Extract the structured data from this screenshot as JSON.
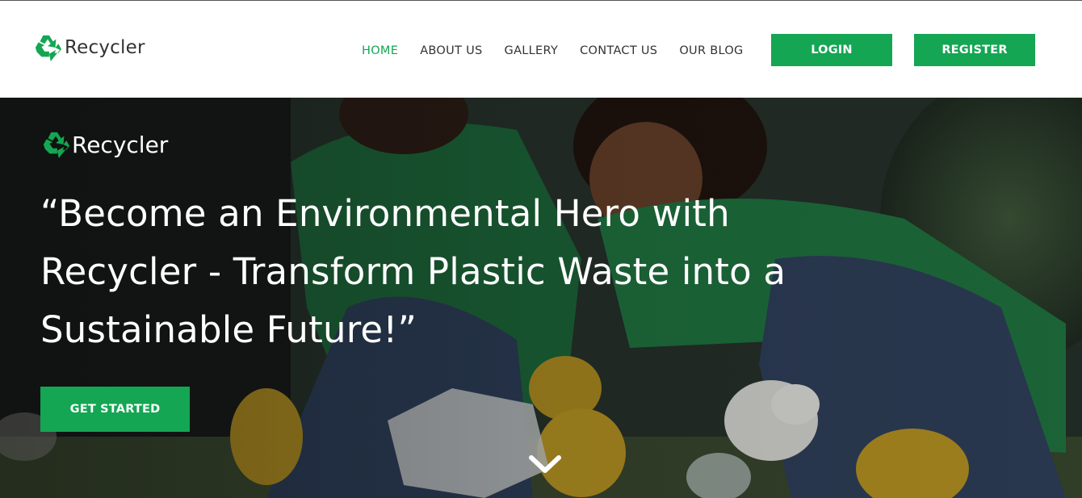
{
  "brand": {
    "name": "Recycler",
    "icon": "recycle-icon",
    "accent_color": "#14a653"
  },
  "nav": {
    "items": [
      {
        "label": "HOME",
        "active": true
      },
      {
        "label": "ABOUT US",
        "active": false
      },
      {
        "label": "GALLERY",
        "active": false
      },
      {
        "label": "CONTACT US",
        "active": false
      },
      {
        "label": "OUR BLOG",
        "active": false
      }
    ],
    "login_label": "LOGIN",
    "register_label": "REGISTER"
  },
  "hero": {
    "brand_name": "Recycler",
    "headline": "“Become an Environmental Hero with Recycler - Transform Plastic Waste into a Sustainable Future!”",
    "cta_label": "GET STARTED",
    "scroll_icon": "chevron-down-icon"
  }
}
